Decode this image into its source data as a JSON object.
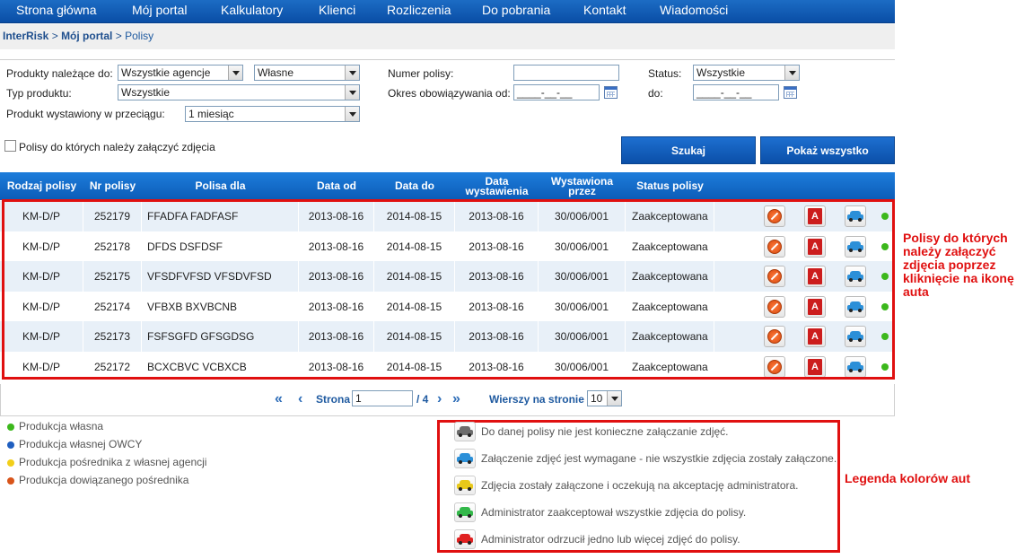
{
  "nav": {
    "items": [
      "Strona główna",
      "Mój portal",
      "Kalkulatory",
      "Klienci",
      "Rozliczenia",
      "Do pobrania",
      "Kontakt",
      "Wiadomości"
    ]
  },
  "breadcrumb": {
    "root": "InterRisk",
    "portal": "Mój portal",
    "current": "Polisy",
    "sep": ">"
  },
  "filters": {
    "products_label": "Produkty należące do:",
    "agency_value": "Wszystkie agencje",
    "own_value": "Własne",
    "type_label": "Typ produktu:",
    "type_value": "Wszystkie",
    "period_label": "Produkt wystawiony w przeciągu:",
    "period_value": "1 miesiąc",
    "policy_no_label": "Numer polisy:",
    "policy_no_value": "",
    "validity_label": "Okres obowiązywania od:",
    "date_from_value": "____-__-__",
    "status_label": "Status:",
    "status_value": "Wszystkie",
    "to_label": "do:",
    "date_to_value": "____-__-__",
    "photos_check_label": "Polisy do których należy załączyć zdjęcia",
    "search_button": "Szukaj",
    "show_all_button": "Pokaż wszystko"
  },
  "table": {
    "headers": {
      "type": "Rodzaj polisy",
      "number": "Nr polisy",
      "for": "Polisa dla",
      "date_from": "Data od",
      "date_to": "Data do",
      "issue_date": "Data wystawienia",
      "issued_by": "Wystawiona przez",
      "status": "Status polisy"
    },
    "rows": [
      {
        "type": "KM-D/P",
        "number": "252179",
        "for": "FFADFA FADFASF",
        "from": "2013-08-16",
        "to": "2014-08-15",
        "issued": "2013-08-16",
        "by": "30/006/001",
        "status": "Zaakceptowana"
      },
      {
        "type": "KM-D/P",
        "number": "252178",
        "for": "DFDS DSFDSF",
        "from": "2013-08-16",
        "to": "2014-08-15",
        "issued": "2013-08-16",
        "by": "30/006/001",
        "status": "Zaakceptowana"
      },
      {
        "type": "KM-D/P",
        "number": "252175",
        "for": "VFSDFVFSD VFSDVFSD",
        "from": "2013-08-16",
        "to": "2014-08-15",
        "issued": "2013-08-16",
        "by": "30/006/001",
        "status": "Zaakceptowana"
      },
      {
        "type": "KM-D/P",
        "number": "252174",
        "for": "VFBXB BXVBCNB",
        "from": "2013-08-16",
        "to": "2014-08-15",
        "issued": "2013-08-16",
        "by": "30/006/001",
        "status": "Zaakceptowana"
      },
      {
        "type": "KM-D/P",
        "number": "252173",
        "for": "FSFSGFD GFSGDSG",
        "from": "2013-08-16",
        "to": "2014-08-15",
        "issued": "2013-08-16",
        "by": "30/006/001",
        "status": "Zaakceptowana"
      },
      {
        "type": "KM-D/P",
        "number": "252172",
        "for": "BCXCBVC VCBXCB",
        "from": "2013-08-16",
        "to": "2014-08-15",
        "issued": "2013-08-16",
        "by": "30/006/001",
        "status": "Zaakceptowana"
      }
    ],
    "row_car_color": "#2b8fd8",
    "row_dot_color": "#3cb81c"
  },
  "pager": {
    "page_label": "Strona",
    "page_value": "1",
    "total": "/ 4",
    "rows_label": "Wierszy na stronie",
    "rows_value": "10"
  },
  "annotations": {
    "rows_note": [
      "Polisy do których",
      "należy załączyć",
      "zdjęcia poprzez",
      "kliknięcie na ikonę",
      "auta"
    ],
    "legend_note": "Legenda kolorów aut"
  },
  "legend_left": [
    {
      "label": "Produkcja własna",
      "color": "#3cb81c"
    },
    {
      "label": "Produkcja własnej OWCY",
      "color": "#1f5fc0"
    },
    {
      "label": "Produkcja pośrednika z własnej agencji",
      "color": "#f2cf1a"
    },
    {
      "label": "Produkcja dowiązanego pośrednika",
      "color": "#d8541a"
    }
  ],
  "legend_cars": [
    {
      "label": "Do danej polisy nie jest konieczne załączanie zdjęć.",
      "color": "#6c6c6c"
    },
    {
      "label": "Załączenie zdjęć jest wymagane - nie wszystkie zdjęcia zostały załączone.",
      "color": "#2b8fd8"
    },
    {
      "label": "Zdjęcia zostały załączone i oczekują na akceptację administratora.",
      "color": "#e8c81a"
    },
    {
      "label": "Administrator zaakceptował wszystkie zdjęcia do polisy.",
      "color": "#33b84a"
    },
    {
      "label": "Administrator odrzucił jedno lub więcej zdjęć do polisy.",
      "color": "#e02020"
    }
  ]
}
